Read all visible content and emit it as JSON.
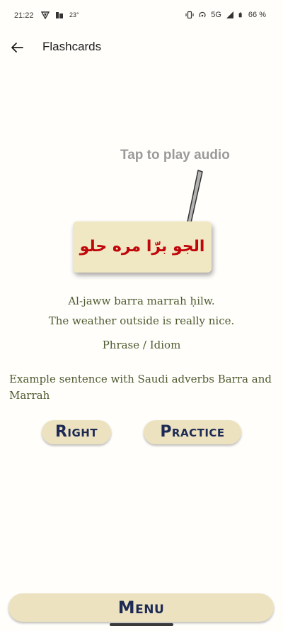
{
  "status_bar": {
    "time": "21:22",
    "temperature": "23°",
    "network": "5G",
    "battery": "66 %"
  },
  "app_bar": {
    "title": "Flashcards"
  },
  "hint": {
    "text": "Tap to play audio"
  },
  "card": {
    "arabic": "الجو برّا مره حلو"
  },
  "details": {
    "transliteration": "Al-jaww barra marrah ḥilw.",
    "translation": "The weather outside is really nice.",
    "category": "Phrase / Idiom",
    "note": "Example sentence with Saudi adverbs Barra and Marrah"
  },
  "buttons": {
    "right": "Right",
    "practice": "Practice",
    "menu": "Menu"
  },
  "colors": {
    "card_bg": "#f0e7c3",
    "arabic_text": "#c0060a",
    "body_text": "#4e5a2f",
    "button_text": "#1c2a55"
  }
}
